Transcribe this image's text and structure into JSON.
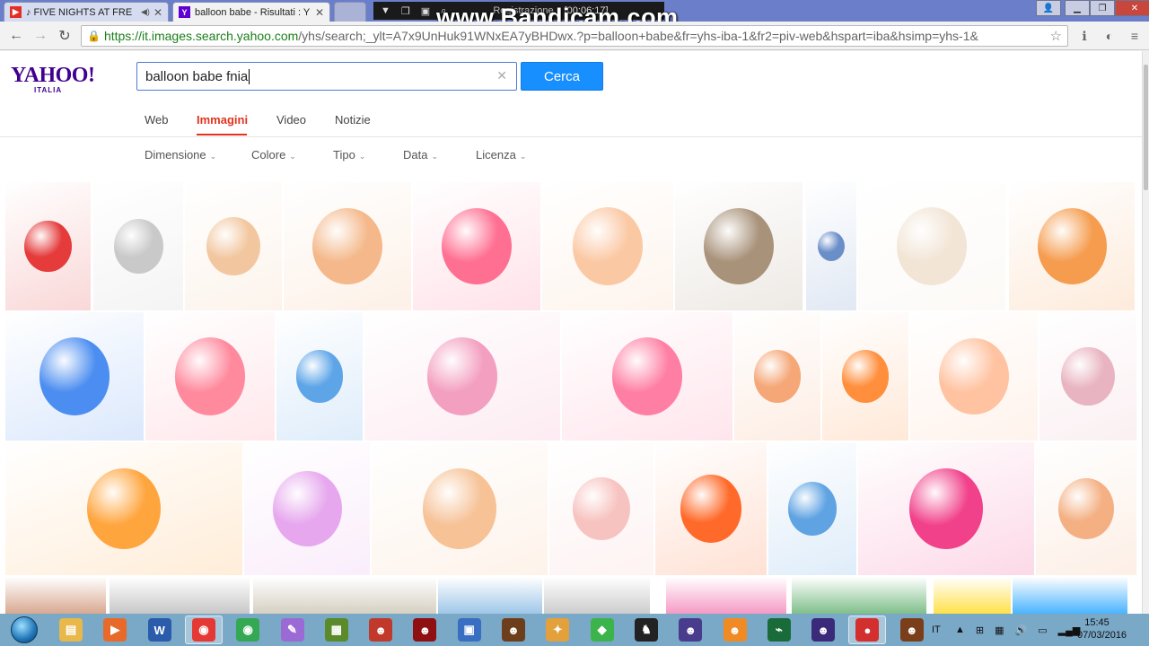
{
  "browser": {
    "tabs": [
      {
        "title": "♪ FIVE NIGHTS AT FRE",
        "icon": "youtube-icon"
      },
      {
        "title": "balloon babe - Risultati : Y",
        "icon": "yahoo-icon"
      }
    ],
    "recorder": {
      "label": "Registrazione",
      "time": "[00:06:17]"
    },
    "watermark": "www.Bandicam.com",
    "url_secure": "https://it.images.search.yahoo.com",
    "url_rest": "/yhs/search;_ylt=A7x9UnHuk91WNxEA7yBHDwx.?p=balloon+babe&fr=yhs-iba-1&fr2=piv-web&hspart=iba&hsimp=yhs-1&"
  },
  "yahoo": {
    "logo": "YAHOO!",
    "logo_sub": "ITALIA",
    "search_value": "balloon babe fnia",
    "search_button": "Cerca",
    "vertical_tabs": [
      "Web",
      "Immagini",
      "Video",
      "Notizie"
    ],
    "filters": [
      "Dimensione",
      "Colore",
      "Tipo",
      "Data",
      "Licenza"
    ]
  },
  "results": {
    "row1": [
      "#e53b3b",
      "#c9c9c9",
      "#f2c7a0",
      "#f4b88a",
      "#ff6f91",
      "#fbc8a4",
      "#a8927a",
      "#6a8ec7",
      "#f2e5d6",
      "#f59c4e"
    ],
    "row2": [
      "#4b8df0",
      "#ff8a9e",
      "#5ea5e8",
      "#f39fc0",
      "#ff7fa4",
      "#f5a778",
      "#ff8f3d",
      "#ffc3a1",
      "#e9b4c1"
    ],
    "row3": [
      "#ffa53e",
      "#e6a7ee",
      "#f6c296",
      "#f7c3c0",
      "#ff6a2a",
      "#5fa3e3",
      "#f1418a",
      "#f4b083"
    ]
  },
  "taskbar": {
    "apps": [
      "folder-icon",
      "media-player-icon",
      "word-icon",
      "chrome-icon",
      "chrome-icon-2",
      "paint-icon",
      "minecraft-icon",
      "fnaf-icon-1",
      "fnaf-icon-2",
      "editor-icon",
      "fnaf-icon-3",
      "game-icon-1",
      "bluestacks-icon",
      "penguin-icon",
      "fnaf-icon-4",
      "cat-game-icon",
      "camtasia-icon",
      "fnaf-icon-5",
      "bandicam-icon",
      "freddy-icon"
    ],
    "lang": "IT",
    "time": "15:45",
    "date": "07/03/2016"
  },
  "colors": {
    "yahoo_purple": "#400090",
    "accent_red": "#e1341e",
    "button_blue": "#188fff"
  }
}
